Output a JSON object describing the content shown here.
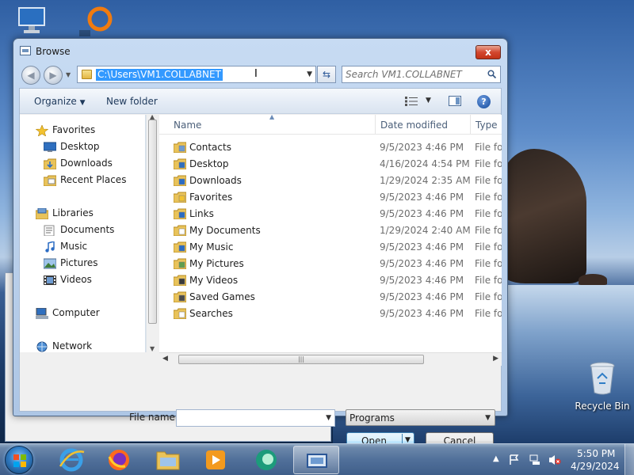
{
  "dialog": {
    "title": "Browse",
    "close_label": "x",
    "address": "C:\\Users\\VM1.COLLABNET",
    "search_placeholder": "Search VM1.COLLABNET",
    "toolbar": {
      "organize_label": "Organize",
      "new_folder_label": "New folder"
    },
    "navigation": {
      "favorites": {
        "label": "Favorites",
        "items": [
          {
            "label": "Desktop",
            "icon": "desktop-folder-icon"
          },
          {
            "label": "Downloads",
            "icon": "downloads-folder-icon"
          },
          {
            "label": "Recent Places",
            "icon": "recent-places-icon"
          }
        ]
      },
      "libraries": {
        "label": "Libraries",
        "items": [
          {
            "label": "Documents",
            "icon": "documents-library-icon"
          },
          {
            "label": "Music",
            "icon": "music-library-icon"
          },
          {
            "label": "Pictures",
            "icon": "pictures-library-icon"
          },
          {
            "label": "Videos",
            "icon": "videos-library-icon"
          }
        ]
      },
      "computer_label": "Computer",
      "network_label": "Network"
    },
    "columns": {
      "name": "Name",
      "date_modified": "Date modified",
      "type": "Type"
    },
    "files": [
      {
        "name": "Contacts",
        "date": "9/5/2023 4:46 PM",
        "type": "File folder"
      },
      {
        "name": "Desktop",
        "date": "4/16/2024 4:54 PM",
        "type": "File folder"
      },
      {
        "name": "Downloads",
        "date": "1/29/2024 2:35 AM",
        "type": "File folder"
      },
      {
        "name": "Favorites",
        "date": "9/5/2023 4:46 PM",
        "type": "File folder"
      },
      {
        "name": "Links",
        "date": "9/5/2023 4:46 PM",
        "type": "File folder"
      },
      {
        "name": "My Documents",
        "date": "1/29/2024 2:40 AM",
        "type": "File folder"
      },
      {
        "name": "My Music",
        "date": "9/5/2023 4:46 PM",
        "type": "File folder"
      },
      {
        "name": "My Pictures",
        "date": "9/5/2023 4:46 PM",
        "type": "File folder"
      },
      {
        "name": "My Videos",
        "date": "9/5/2023 4:46 PM",
        "type": "File folder"
      },
      {
        "name": "Saved Games",
        "date": "9/5/2023 4:46 PM",
        "type": "File folder"
      },
      {
        "name": "Searches",
        "date": "9/5/2023 4:46 PM",
        "type": "File folder"
      }
    ],
    "file_name_label": "File name:",
    "file_name_value": "",
    "file_type_selected": "Programs",
    "open_label": "Open",
    "cancel_label": "Cancel"
  },
  "desktop": {
    "recycle_bin_label": "Recycle Bin"
  },
  "taskbar": {
    "apps": [
      "internet-explorer-icon",
      "firefox-icon",
      "file-explorer-icon",
      "media-player-icon",
      "browser-app-icon",
      "remote-desktop-icon"
    ],
    "clock_time": "5:50 PM",
    "clock_date": "4/29/2024"
  },
  "colors": {
    "selection": "#3399ff",
    "link_text": "#1e395b",
    "dialog_frame": "#b9cfea",
    "taskbar": "#51709a"
  }
}
